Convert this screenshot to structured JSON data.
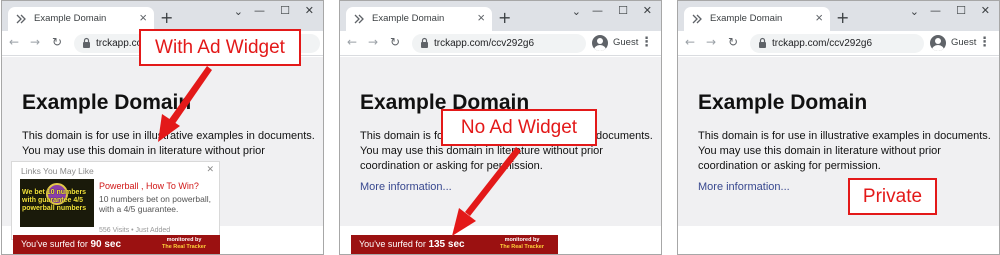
{
  "panels": [
    {
      "tab_title": "Example Domain",
      "url": "trckapp.com",
      "show_guest": false,
      "heading": "Example Domain",
      "paragraph": "This domain is for use in illustrative examples in documents. You may use this domain in literature without prior",
      "more_link": "",
      "callout": "With Ad Widget"
    },
    {
      "tab_title": "Example Domain",
      "url": "trckapp.com/ccv292g6",
      "show_guest": true,
      "guest_label": "Guest",
      "heading": "Example Domain",
      "paragraph": "This domain is for use in illustrative examples in documents. You may use this domain in literature without prior coordination or asking for permission.",
      "more_link": "More information...",
      "callout": "No Ad Widget"
    },
    {
      "tab_title": "Example Domain",
      "url": "trckapp.com/ccv292g6",
      "show_guest": true,
      "guest_label": "Guest",
      "heading": "Example Domain",
      "paragraph": "This domain is for use in illustrative examples in documents. You may use this domain in literature without prior coordination or asking for permission.",
      "more_link": "More information...",
      "callout": "Private"
    }
  ],
  "widget": {
    "title": "Links You May Like",
    "close": "✕",
    "thumb_text": "We bet 10 numbers with guarantee 4/5 powerball numbers",
    "ad_title": "Powerball , How To Win?",
    "ad_desc": "10 numbers bet on powerball, with a 4/5 guarantee.",
    "ad_meta": "556 Visits • Just Added"
  },
  "trackers": [
    {
      "prefix": "You've surfed for ",
      "seconds": "90 sec",
      "monitored": "monitored by",
      "brand": "The Real Tracker"
    },
    {
      "prefix": "You've surfed for ",
      "seconds": "135 sec",
      "monitored": "monitored by",
      "brand": "The Real Tracker"
    }
  ],
  "icons": {
    "favicon": "double-chevron-icon",
    "close": "×",
    "new_tab": "+",
    "back": "←",
    "forward": "→",
    "reload": "↻",
    "menu": "⋮",
    "min": "—",
    "max": "☐",
    "win_close": "✕",
    "tab_search": "⌄"
  },
  "colors": {
    "callout_red": "#e31919",
    "tracker_bg": "#9b1111",
    "ad_title_red": "#d01616",
    "link_blue": "#38488f",
    "page_bg": "#f0f0f2"
  }
}
